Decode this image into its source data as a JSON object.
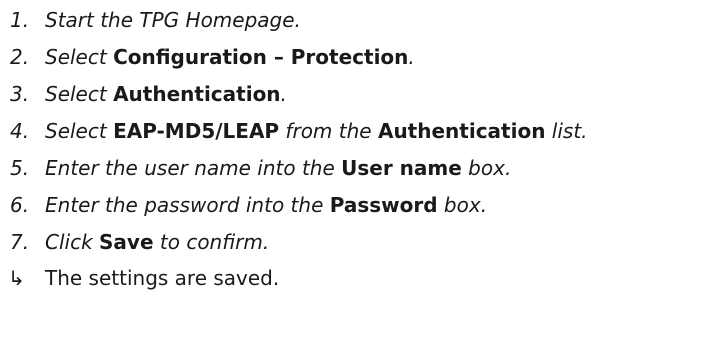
{
  "steps": [
    {
      "num": "1.",
      "parts": [
        {
          "t": "Start the TPG Homepage.",
          "b": false
        }
      ]
    },
    {
      "num": "2.",
      "parts": [
        {
          "t": "Select ",
          "b": false
        },
        {
          "t": "Configuration – Protection",
          "b": true
        },
        {
          "t": ".",
          "b": false
        }
      ]
    },
    {
      "num": "3.",
      "parts": [
        {
          "t": "Select ",
          "b": false
        },
        {
          "t": "Authentication",
          "b": true
        },
        {
          "t": ".",
          "b": false
        }
      ]
    },
    {
      "num": "4.",
      "parts": [
        {
          "t": "Select ",
          "b": false
        },
        {
          "t": "EAP-MD5/LEAP",
          "b": true
        },
        {
          "t": " from the ",
          "b": false
        },
        {
          "t": "Authentication",
          "b": true
        },
        {
          "t": " list.",
          "b": false
        }
      ]
    },
    {
      "num": "5.",
      "parts": [
        {
          "t": "Enter the user name into the ",
          "b": false
        },
        {
          "t": "User name",
          "b": true
        },
        {
          "t": " box.",
          "b": false
        }
      ]
    },
    {
      "num": "6.",
      "parts": [
        {
          "t": "Enter the password into the ",
          "b": false
        },
        {
          "t": "Password",
          "b": true
        },
        {
          "t": " box.",
          "b": false
        }
      ]
    },
    {
      "num": "7.",
      "parts": [
        {
          "t": "Click ",
          "b": false
        },
        {
          "t": "Save",
          "b": true
        },
        {
          "t": " to confirm.",
          "b": false
        }
      ]
    }
  ],
  "result": {
    "icon": "result-arrow-icon",
    "glyph": "↳",
    "text": "The settings are saved."
  }
}
